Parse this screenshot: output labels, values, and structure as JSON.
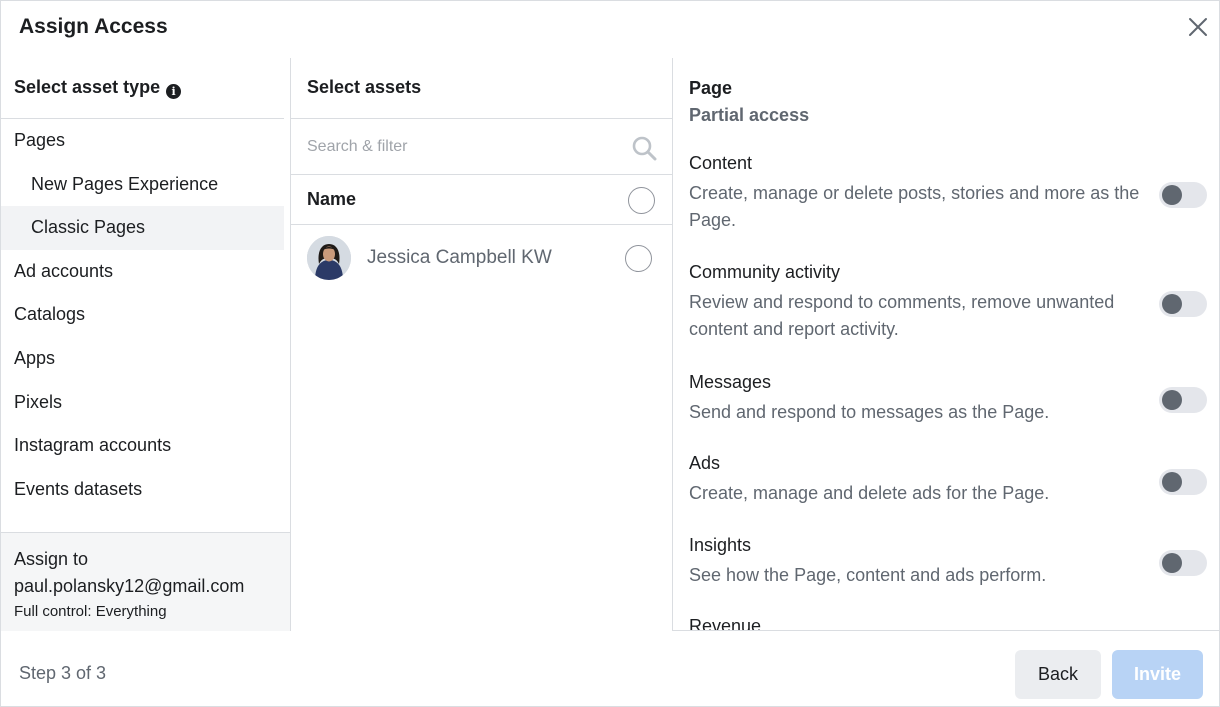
{
  "dialog": {
    "title": "Assign Access"
  },
  "left": {
    "heading": "Select asset type",
    "items": [
      {
        "label": "Pages"
      },
      {
        "label": "New Pages Experience"
      },
      {
        "label": "Classic Pages"
      },
      {
        "label": "Ad accounts"
      },
      {
        "label": "Catalogs"
      },
      {
        "label": "Apps"
      },
      {
        "label": "Pixels"
      },
      {
        "label": "Instagram accounts"
      },
      {
        "label": "Events datasets"
      }
    ],
    "assign": {
      "label": "Assign to",
      "email": "paul.polansky12@gmail.com",
      "control": "Full control: Everything"
    }
  },
  "middle": {
    "heading": "Select assets",
    "search_placeholder": "Search & filter",
    "name_header": "Name",
    "assets": [
      {
        "name": "Jessica Campbell KW"
      }
    ]
  },
  "right": {
    "title": "Page",
    "subtitle": "Partial access",
    "permissions": [
      {
        "name": "Content",
        "desc": "Create, manage or delete posts, stories and more as the Page.",
        "enabled": false
      },
      {
        "name": "Community activity",
        "desc": "Review and respond to comments, remove unwanted content and report activity.",
        "enabled": false
      },
      {
        "name": "Messages",
        "desc": "Send and respond to messages as the Page.",
        "enabled": false
      },
      {
        "name": "Ads",
        "desc": "Create, manage and delete ads for the Page.",
        "enabled": false
      },
      {
        "name": "Insights",
        "desc": "See how the Page, content and ads perform.",
        "enabled": false
      },
      {
        "name": "Revenue",
        "desc": "",
        "enabled": false
      }
    ]
  },
  "footer": {
    "step": "Step 3 of 3",
    "back": "Back",
    "invite": "Invite"
  }
}
